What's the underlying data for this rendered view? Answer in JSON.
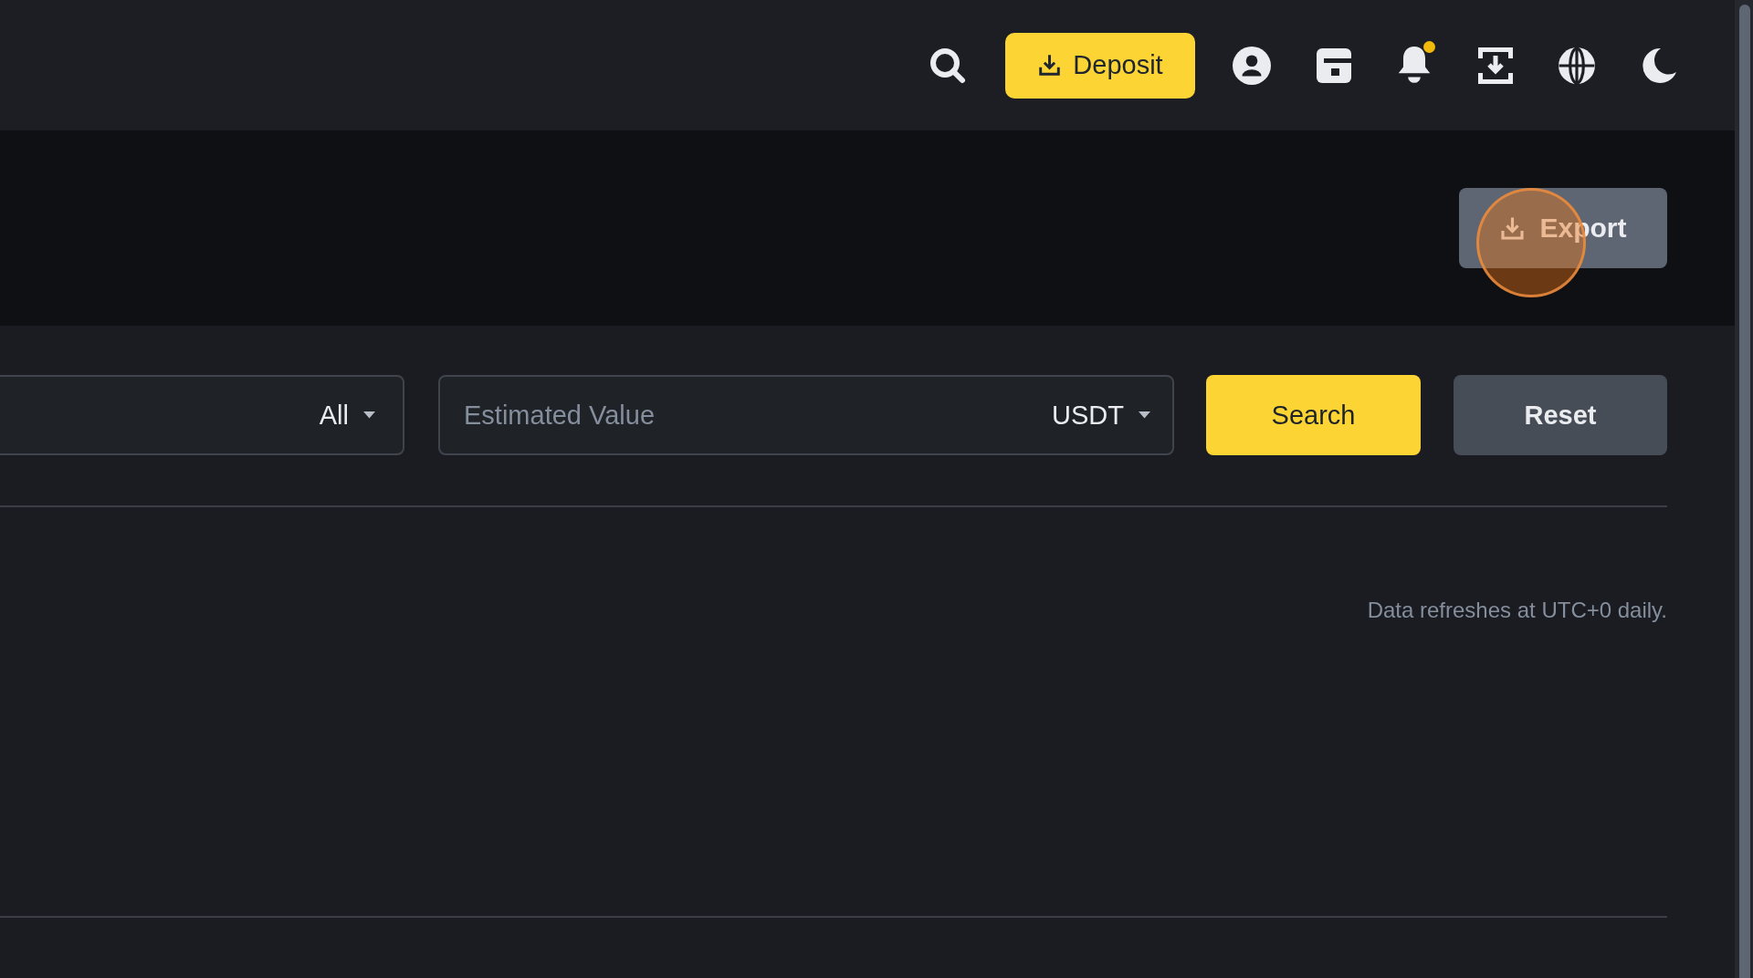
{
  "top_bar": {
    "deposit_button": "Deposit",
    "notification_unread": true
  },
  "header": {
    "export_button": "Export"
  },
  "filters": [
    {
      "kind": "dropdown",
      "value": "All"
    },
    {
      "kind": "amount",
      "placeholder": "Estimated Value",
      "unit": "USDT"
    }
  ],
  "actions": [
    {
      "kind": "primary",
      "label": "Search"
    },
    {
      "kind": "secondary",
      "label": "Reset"
    }
  ],
  "note": "Data refreshes at UTC+0 daily."
}
